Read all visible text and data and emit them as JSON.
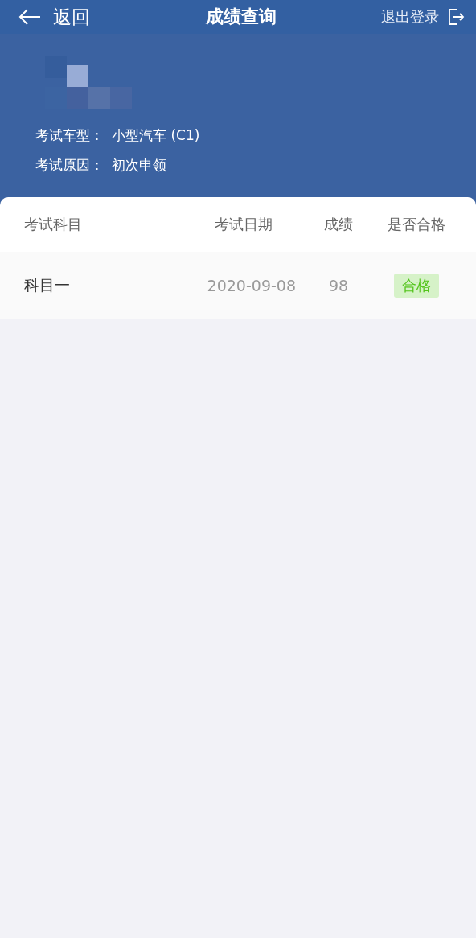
{
  "nav": {
    "back": "返回",
    "title": "成绩查询",
    "logout": "退出登录"
  },
  "profile": {
    "fields": [
      {
        "label": "考试车型：",
        "value": "小型汽车 (C1)"
      },
      {
        "label": "考试原因：",
        "value": "初次申领"
      }
    ]
  },
  "table": {
    "columns": [
      "考试科目",
      "考试日期",
      "成绩",
      "是否合格"
    ],
    "rows": [
      {
        "subject": "科目一",
        "date": "2020-09-08",
        "score": "98",
        "result": {
          "text": "合格",
          "passed": true
        }
      }
    ]
  }
}
